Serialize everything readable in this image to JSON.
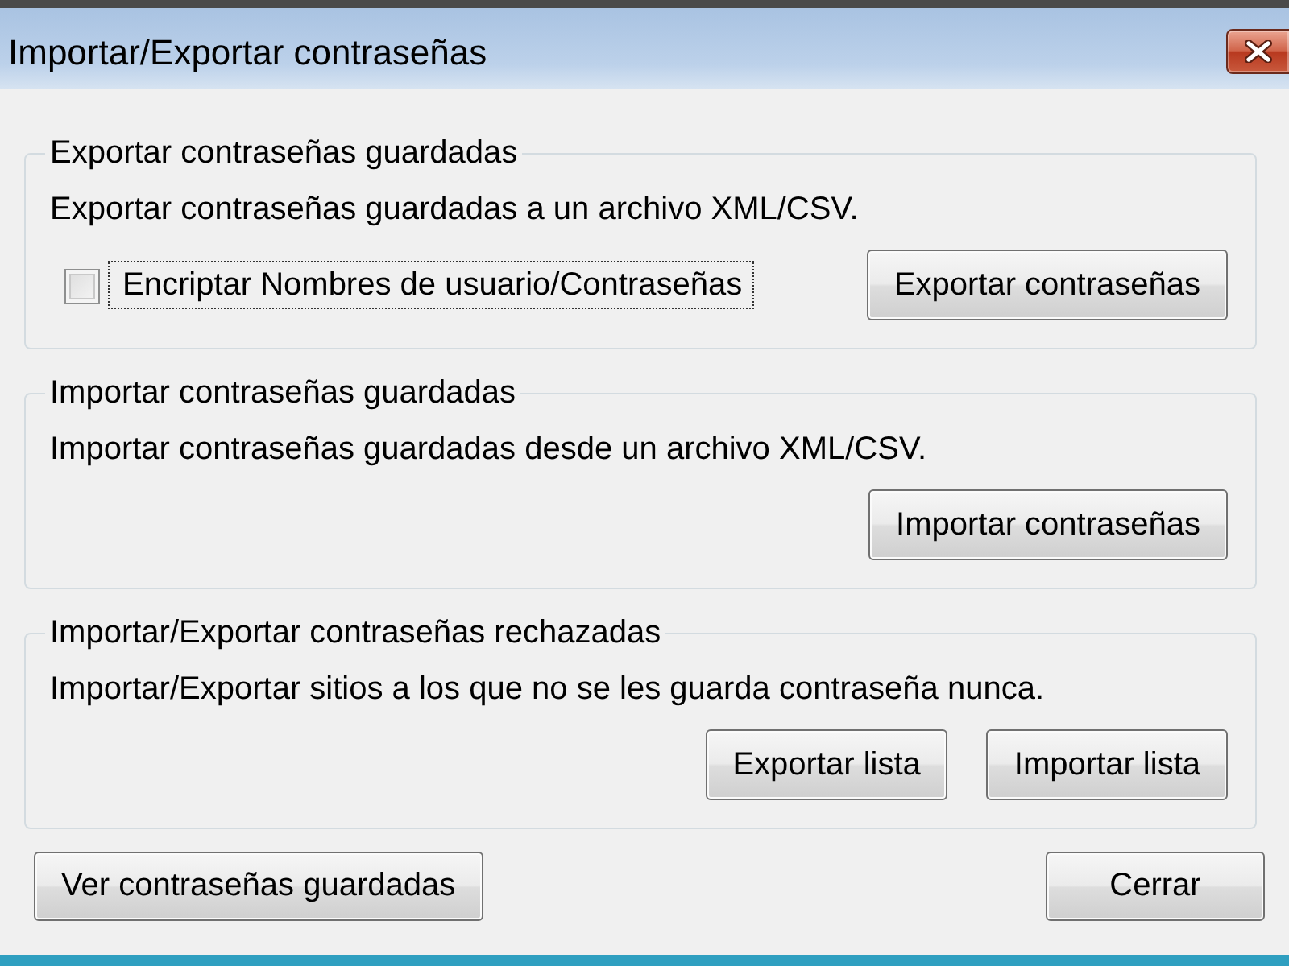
{
  "window": {
    "title": "Importar/Exportar contraseñas"
  },
  "groups": [
    {
      "title": "Exportar contraseñas guardadas",
      "description": "Exportar contraseñas guardadas a un archivo XML/CSV.",
      "checkbox": {
        "label": "Encriptar Nombres de usuario/Contraseñas",
        "checked": false,
        "focused": true
      },
      "buttons": [
        "Exportar contraseñas"
      ]
    },
    {
      "title": "Importar contraseñas guardadas",
      "description": "Importar contraseñas guardadas desde un archivo XML/CSV.",
      "buttons": [
        "Importar contraseñas"
      ]
    },
    {
      "title": "Importar/Exportar contraseñas rechazadas",
      "description": "Importar/Exportar sitios a los que no se les guarda contraseña nunca.",
      "buttons": [
        "Exportar lista",
        "Importar lista"
      ]
    }
  ],
  "footer_buttons": [
    "Ver contraseñas guardadas",
    "Cerrar"
  ]
}
